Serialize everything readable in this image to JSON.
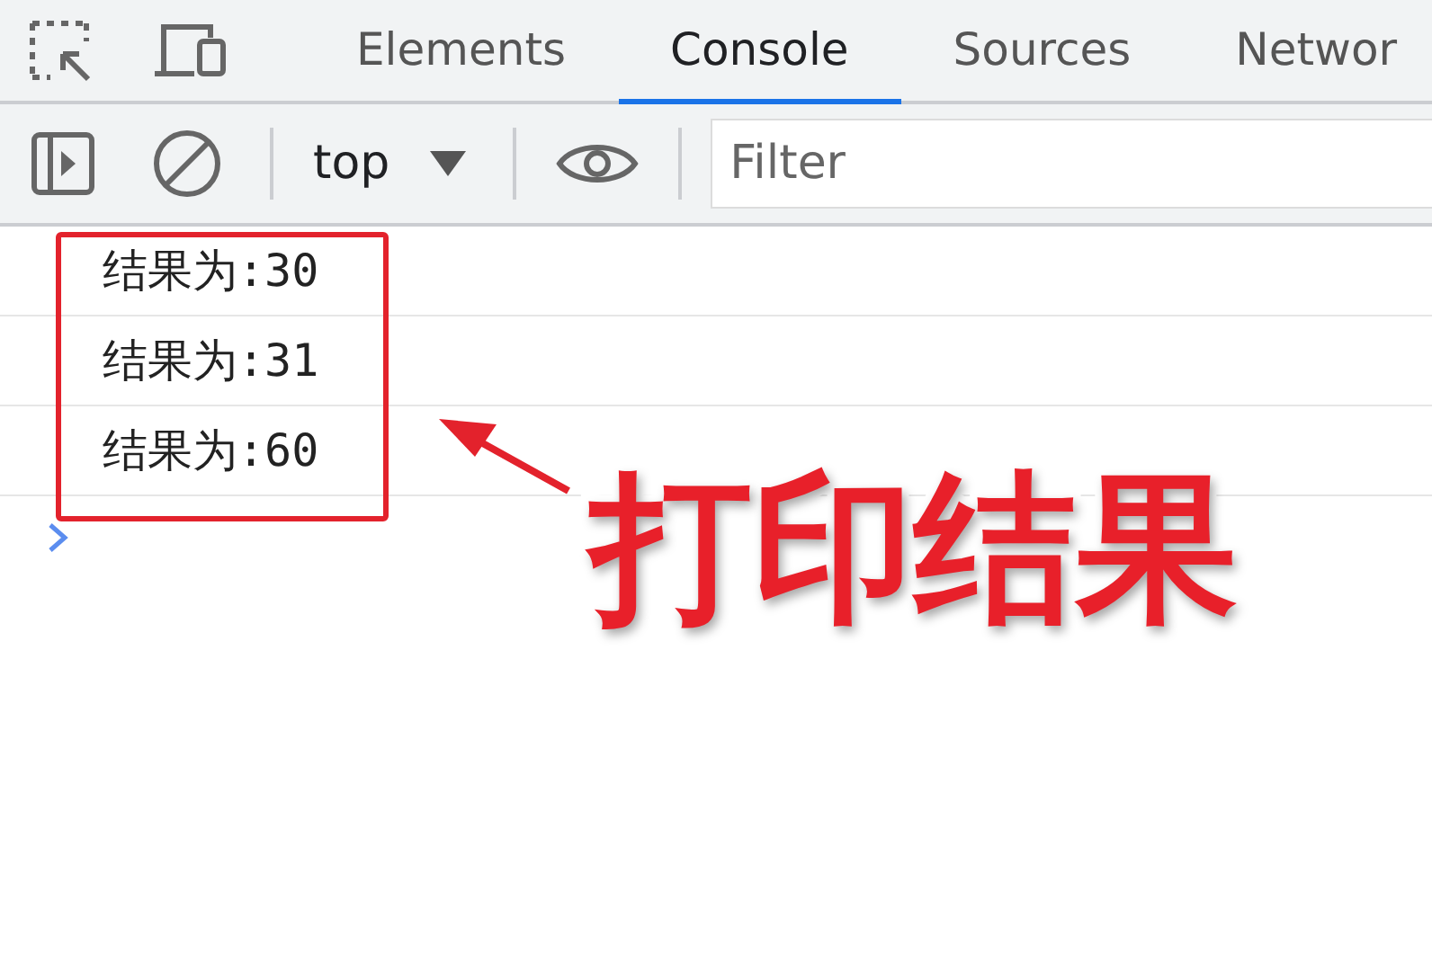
{
  "tabs": [
    {
      "label": "Elements",
      "selected": false
    },
    {
      "label": "Console",
      "selected": true
    },
    {
      "label": "Sources",
      "selected": false
    },
    {
      "label": "Networ",
      "selected": false
    }
  ],
  "toolbar": {
    "context": "top",
    "filter": {
      "placeholder": "Filter"
    }
  },
  "console": {
    "messages": [
      "结果为:30",
      "结果为:31",
      "结果为:60"
    ]
  },
  "annotation": {
    "caption": "打印结果"
  }
}
